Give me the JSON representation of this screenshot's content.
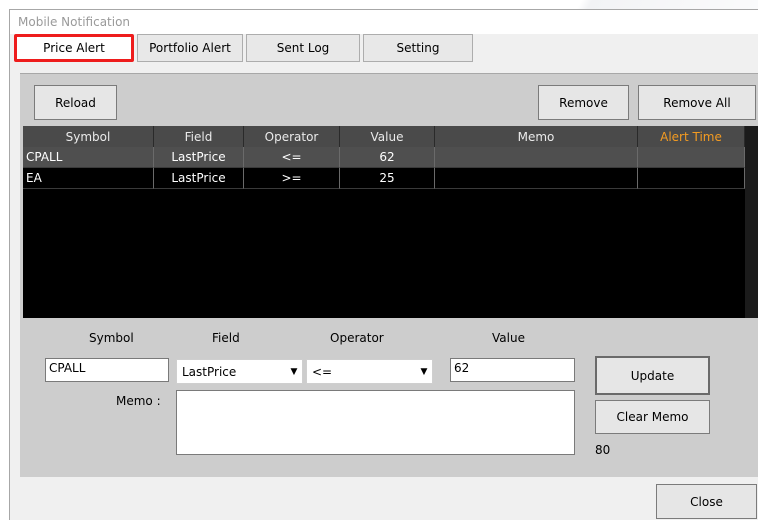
{
  "window": {
    "title": "Mobile Notification"
  },
  "tabs": [
    {
      "label": "Price Alert"
    },
    {
      "label": "Portfolio Alert"
    },
    {
      "label": "Sent Log"
    },
    {
      "label": "Setting"
    }
  ],
  "toolbar": {
    "reload": "Reload",
    "remove": "Remove",
    "remove_all": "Remove All"
  },
  "grid": {
    "columns": [
      "Symbol",
      "Field",
      "Operator",
      "Value",
      "Memo",
      "Alert Time"
    ],
    "rows": [
      {
        "symbol": "CPALL",
        "field": "LastPrice",
        "operator": "<=",
        "value": "62",
        "memo": "",
        "alert_time": ""
      },
      {
        "symbol": "EA",
        "field": "LastPrice",
        "operator": ">=",
        "value": "25",
        "memo": "",
        "alert_time": ""
      }
    ],
    "header_highlight_color": "#f39b22"
  },
  "form": {
    "symbol_label": "Symbol",
    "field_label": "Field",
    "operator_label": "Operator",
    "value_label": "Value",
    "memo_label": "Memo :",
    "symbol_value": "CPALL",
    "field_value": "LastPrice",
    "operator_value": "<=",
    "value_value": "62",
    "memo_value": "",
    "memo_remaining": "80",
    "update": "Update",
    "clear_memo": "Clear Memo"
  },
  "footer": {
    "close": "Close"
  },
  "colors": {
    "active_tab_border": "#ee1c1c"
  }
}
